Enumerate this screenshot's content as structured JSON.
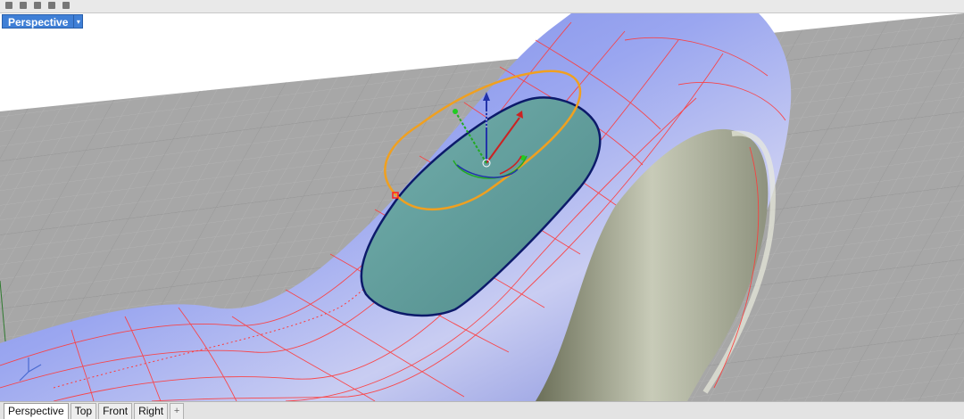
{
  "viewport": {
    "title": "Perspective",
    "menu_arrow": "▾"
  },
  "tabs": [
    {
      "label": "Perspective"
    },
    {
      "label": "Top"
    },
    {
      "label": "Front"
    },
    {
      "label": "Right"
    }
  ],
  "add_tab_label": "+",
  "icons": {
    "gumball": "gumball-icon",
    "world_axes": "world-axes-icon"
  },
  "colors": {
    "active_title": "#3f7fd6",
    "surface_blue": "#7d8ee8",
    "isocurve": "#ff3a3a",
    "face_fill": "#5e9a9a",
    "orange_curve": "#f0a020"
  }
}
